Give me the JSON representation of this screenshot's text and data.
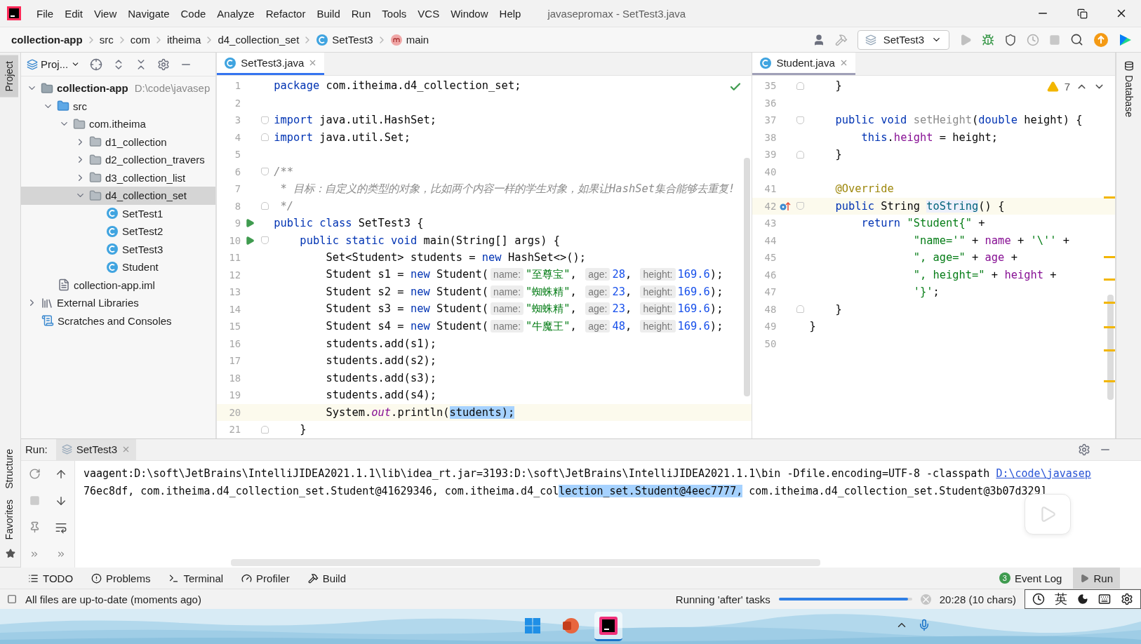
{
  "window": {
    "title": "javasepromax - SetTest3.java"
  },
  "menu": [
    "File",
    "Edit",
    "View",
    "Navigate",
    "Code",
    "Analyze",
    "Refactor",
    "Build",
    "Run",
    "Tools",
    "VCS",
    "Window",
    "Help"
  ],
  "breadcrumbs": [
    {
      "label": "collection-app",
      "kind": "project"
    },
    {
      "label": "src",
      "kind": "folder"
    },
    {
      "label": "com",
      "kind": "folder"
    },
    {
      "label": "itheima",
      "kind": "folder"
    },
    {
      "label": "d4_collection_set",
      "kind": "folder"
    },
    {
      "label": "SetTest3",
      "kind": "class"
    },
    {
      "label": "main",
      "kind": "method"
    }
  ],
  "run_configuration": {
    "label": "SetTest3"
  },
  "side_tabs_left": [
    {
      "label": "Project",
      "selected": true
    },
    {
      "label": "Structure",
      "selected": false
    },
    {
      "label": "Favorites",
      "selected": false
    }
  ],
  "side_tabs_right": [
    {
      "label": "Database",
      "selected": false
    }
  ],
  "project_panel": {
    "view": "Proj...",
    "tree": [
      {
        "label": "collection-app",
        "path": "D:\\code\\javasep",
        "kind": "module",
        "expanded": true,
        "selected": false,
        "children": [
          {
            "label": "src",
            "kind": "source",
            "expanded": true,
            "selected": false,
            "children": [
              {
                "label": "com.itheima",
                "kind": "package",
                "expanded": true,
                "selected": false,
                "children": [
                  {
                    "label": "d1_collection",
                    "kind": "package",
                    "expanded": false,
                    "selected": false
                  },
                  {
                    "label": "d2_collection_travers",
                    "kind": "package",
                    "expanded": false,
                    "selected": false
                  },
                  {
                    "label": "d3_collection_list",
                    "kind": "package",
                    "expanded": false,
                    "selected": false
                  },
                  {
                    "label": "d4_collection_set",
                    "kind": "package",
                    "expanded": true,
                    "selected": true,
                    "children": [
                      {
                        "label": "SetTest1",
                        "kind": "class",
                        "selected": false
                      },
                      {
                        "label": "SetTest2",
                        "kind": "class",
                        "selected": false
                      },
                      {
                        "label": "SetTest3",
                        "kind": "class",
                        "selected": false
                      },
                      {
                        "label": "Student",
                        "kind": "class",
                        "selected": false
                      }
                    ]
                  }
                ]
              }
            ]
          },
          {
            "label": "collection-app.iml",
            "kind": "iml",
            "selected": false
          }
        ]
      },
      {
        "label": "External Libraries",
        "kind": "library",
        "expanded": false,
        "selected": false
      },
      {
        "label": "Scratches and Consoles",
        "kind": "scratches",
        "selected": false
      }
    ]
  },
  "editors": [
    {
      "focused": true,
      "tab": {
        "label": "SetTest3.java",
        "selected": true
      },
      "indicator": {
        "kind": "ok"
      },
      "lines": [
        {
          "number": "1",
          "current": false,
          "tokens": [
            {
              "kind": "keyword",
              "text": "package"
            },
            {
              "kind": "plain",
              "text": " com.itheima.d4_collection_set;"
            }
          ]
        },
        {
          "number": "2",
          "current": false
        },
        {
          "number": "3",
          "current": false,
          "marks": [
            {
              "kind": "fold-start"
            }
          ],
          "tokens": [
            {
              "kind": "keyword",
              "text": "import"
            },
            {
              "kind": "plain",
              "text": " java.util.HashSet;"
            }
          ]
        },
        {
          "number": "4",
          "current": false,
          "marks": [
            {
              "kind": "fold-end"
            }
          ],
          "tokens": [
            {
              "kind": "keyword",
              "text": "import"
            },
            {
              "kind": "plain",
              "text": " java.util.Set;"
            }
          ]
        },
        {
          "number": "5",
          "current": false
        },
        {
          "number": "6",
          "current": false,
          "marks": [
            {
              "kind": "fold-start"
            }
          ],
          "tokens": [
            {
              "kind": "comment",
              "text": "/**"
            }
          ]
        },
        {
          "number": "7",
          "current": false,
          "tokens": [
            {
              "kind": "comment",
              "text": " * 目标：自定义的类型的对象，比如两个内容一样的学生对象，如果让HashSet集合能够去重复!"
            }
          ]
        },
        {
          "number": "8",
          "current": false,
          "marks": [
            {
              "kind": "fold-end"
            }
          ],
          "tokens": [
            {
              "kind": "comment",
              "text": " */"
            }
          ]
        },
        {
          "number": "9",
          "current": false,
          "marks": [
            {
              "kind": "run"
            }
          ],
          "tokens": [
            {
              "kind": "keyword",
              "text": "public class"
            },
            {
              "kind": "plain",
              "text": " SetTest3 {"
            }
          ]
        },
        {
          "number": "10",
          "current": false,
          "marks": [
            {
              "kind": "run"
            },
            {
              "kind": "fold-start"
            }
          ],
          "tokens": [
            {
              "kind": "keyword",
              "text": "    public static void"
            },
            {
              "kind": "plain",
              "text": " main(String[] args) {"
            }
          ]
        },
        {
          "number": "11",
          "current": false,
          "tokens": [
            {
              "kind": "plain",
              "text": "        Set<Student> students = "
            },
            {
              "kind": "keyword",
              "text": "new"
            },
            {
              "kind": "plain",
              "text": " HashSet<>();"
            }
          ]
        },
        {
          "number": "12",
          "current": false,
          "tokens": [
            {
              "kind": "plain",
              "text": "        Student s1 = "
            },
            {
              "kind": "keyword",
              "text": "new"
            },
            {
              "kind": "plain",
              "text": " Student("
            },
            {
              "kind": "hint",
              "text": "name:"
            },
            {
              "kind": "string",
              "text": "\"至尊宝\""
            },
            {
              "kind": "plain",
              "text": ", "
            },
            {
              "kind": "hint",
              "text": "age:"
            },
            {
              "kind": "number",
              "text": "28"
            },
            {
              "kind": "plain",
              "text": ", "
            },
            {
              "kind": "hint",
              "text": "height:"
            },
            {
              "kind": "number",
              "text": "169.6"
            },
            {
              "kind": "plain",
              "text": ");"
            }
          ]
        },
        {
          "number": "13",
          "current": false,
          "tokens": [
            {
              "kind": "plain",
              "text": "        Student s2 = "
            },
            {
              "kind": "keyword",
              "text": "new"
            },
            {
              "kind": "plain",
              "text": " Student("
            },
            {
              "kind": "hint",
              "text": "name:"
            },
            {
              "kind": "string",
              "text": "\"蜘蛛精\""
            },
            {
              "kind": "plain",
              "text": ", "
            },
            {
              "kind": "hint",
              "text": "age:"
            },
            {
              "kind": "number",
              "text": "23"
            },
            {
              "kind": "plain",
              "text": ", "
            },
            {
              "kind": "hint",
              "text": "height:"
            },
            {
              "kind": "number",
              "text": "169.6"
            },
            {
              "kind": "plain",
              "text": ");"
            }
          ]
        },
        {
          "number": "14",
          "current": false,
          "tokens": [
            {
              "kind": "plain",
              "text": "        Student s3 = "
            },
            {
              "kind": "keyword",
              "text": "new"
            },
            {
              "kind": "plain",
              "text": " Student("
            },
            {
              "kind": "hint",
              "text": "name:"
            },
            {
              "kind": "string",
              "text": "\"蜘蛛精\""
            },
            {
              "kind": "plain",
              "text": ", "
            },
            {
              "kind": "hint",
              "text": "age:"
            },
            {
              "kind": "number",
              "text": "23"
            },
            {
              "kind": "plain",
              "text": ", "
            },
            {
              "kind": "hint",
              "text": "height:"
            },
            {
              "kind": "number",
              "text": "169.6"
            },
            {
              "kind": "plain",
              "text": ");"
            }
          ]
        },
        {
          "number": "15",
          "current": false,
          "tokens": [
            {
              "kind": "plain",
              "text": "        Student s4 = "
            },
            {
              "kind": "keyword",
              "text": "new"
            },
            {
              "kind": "plain",
              "text": " Student("
            },
            {
              "kind": "hint",
              "text": "name:"
            },
            {
              "kind": "string",
              "text": "\"牛魔王\""
            },
            {
              "kind": "plain",
              "text": ", "
            },
            {
              "kind": "hint",
              "text": "age:"
            },
            {
              "kind": "number",
              "text": "48"
            },
            {
              "kind": "plain",
              "text": ", "
            },
            {
              "kind": "hint",
              "text": "height:"
            },
            {
              "kind": "number",
              "text": "169.6"
            },
            {
              "kind": "plain",
              "text": ");"
            }
          ]
        },
        {
          "number": "16",
          "current": false,
          "tokens": [
            {
              "kind": "plain",
              "text": "        students.add(s1);"
            }
          ]
        },
        {
          "number": "17",
          "current": false,
          "tokens": [
            {
              "kind": "plain",
              "text": "        students.add(s2);"
            }
          ]
        },
        {
          "number": "18",
          "current": false,
          "tokens": [
            {
              "kind": "plain",
              "text": "        students.add(s3);"
            }
          ]
        },
        {
          "number": "19",
          "current": false,
          "tokens": [
            {
              "kind": "plain",
              "text": "        students.add(s4);"
            }
          ]
        },
        {
          "number": "20",
          "current": true,
          "tokens": [
            {
              "kind": "plain",
              "text": "        System."
            },
            {
              "kind": "static",
              "text": "out"
            },
            {
              "kind": "plain",
              "text": ".println("
            },
            {
              "kind": "selected",
              "text": "students);"
            }
          ]
        },
        {
          "number": "21",
          "current": false,
          "marks": [
            {
              "kind": "fold-end"
            }
          ],
          "tokens": [
            {
              "kind": "plain",
              "text": "    }"
            }
          ]
        }
      ]
    },
    {
      "focused": false,
      "tab": {
        "label": "Student.java",
        "selected": true
      },
      "indicator": {
        "kind": "warnings",
        "count": "7"
      },
      "lines": [
        {
          "number": "35",
          "current": false,
          "marks": [
            {
              "kind": "fold-end"
            }
          ],
          "tokens": [
            {
              "kind": "plain",
              "text": "    }"
            }
          ]
        },
        {
          "number": "36",
          "current": false
        },
        {
          "number": "37",
          "current": false,
          "marks": [
            {
              "kind": "fold-start"
            }
          ],
          "tokens": [
            {
              "kind": "keyword",
              "text": "    public void "
            },
            {
              "kind": "unused",
              "text": "setHeight"
            },
            {
              "kind": "plain",
              "text": "("
            },
            {
              "kind": "keyword",
              "text": "double"
            },
            {
              "kind": "plain",
              "text": " height) {"
            }
          ]
        },
        {
          "number": "38",
          "current": false,
          "tokens": [
            {
              "kind": "keyword",
              "text": "        this"
            },
            {
              "kind": "plain",
              "text": "."
            },
            {
              "kind": "field",
              "text": "height"
            },
            {
              "kind": "plain",
              "text": " = height;"
            }
          ]
        },
        {
          "number": "39",
          "current": false,
          "marks": [
            {
              "kind": "fold-end"
            }
          ],
          "tokens": [
            {
              "kind": "plain",
              "text": "    }"
            }
          ]
        },
        {
          "number": "40",
          "current": false
        },
        {
          "number": "41",
          "current": false,
          "tokens": [
            {
              "kind": "annotation",
              "text": "    @Override"
            }
          ]
        },
        {
          "number": "42",
          "current": true,
          "marks": [
            {
              "kind": "override"
            },
            {
              "kind": "fold-start"
            }
          ],
          "tokens": [
            {
              "kind": "keyword",
              "text": "    public"
            },
            {
              "kind": "plain",
              "text": " String "
            },
            {
              "kind": "method",
              "text": "toString"
            },
            {
              "kind": "plain",
              "text": "() {"
            }
          ]
        },
        {
          "number": "43",
          "current": false,
          "tokens": [
            {
              "kind": "keyword",
              "text": "        return"
            },
            {
              "kind": "string",
              "text": " \"Student{\""
            },
            {
              "kind": "plain",
              "text": " +"
            }
          ]
        },
        {
          "number": "44",
          "current": false,
          "tokens": [
            {
              "kind": "string",
              "text": "                \"name='\""
            },
            {
              "kind": "plain",
              "text": " + "
            },
            {
              "kind": "field",
              "text": "name"
            },
            {
              "kind": "plain",
              "text": " + "
            },
            {
              "kind": "string",
              "text": "'\\''"
            },
            {
              "kind": "plain",
              "text": " +"
            }
          ]
        },
        {
          "number": "45",
          "current": false,
          "tokens": [
            {
              "kind": "string",
              "text": "                \", age=\""
            },
            {
              "kind": "plain",
              "text": " + "
            },
            {
              "kind": "field",
              "text": "age"
            },
            {
              "kind": "plain",
              "text": " +"
            }
          ]
        },
        {
          "number": "46",
          "current": false,
          "tokens": [
            {
              "kind": "string",
              "text": "                \", height=\""
            },
            {
              "kind": "plain",
              "text": " + "
            },
            {
              "kind": "field",
              "text": "height"
            },
            {
              "kind": "plain",
              "text": " +"
            }
          ]
        },
        {
          "number": "47",
          "current": false,
          "tokens": [
            {
              "kind": "string",
              "text": "                '}'"
            },
            {
              "kind": "plain",
              "text": ";"
            }
          ]
        },
        {
          "number": "48",
          "current": false,
          "marks": [
            {
              "kind": "fold-end"
            }
          ],
          "tokens": [
            {
              "kind": "plain",
              "text": "    }"
            }
          ]
        },
        {
          "number": "49",
          "current": false,
          "tokens": [
            {
              "kind": "plain",
              "text": "}"
            }
          ]
        },
        {
          "number": "50",
          "current": false
        }
      ]
    }
  ],
  "run_panel": {
    "label": "Run:",
    "tab": {
      "label": "SetTest3",
      "selected": true
    },
    "console": [
      [
        {
          "kind": "plain",
          "text": "vaagent:D:\\soft\\JetBrains\\IntelliJIDEA2021.1.1\\lib\\idea_rt.jar=3193:D:\\soft\\JetBrains\\IntelliJIDEA2021.1.1\\bin -Dfile.encoding=UTF-8 -classpath "
        },
        {
          "kind": "link",
          "text": "D:\\code\\javasep"
        }
      ],
      [
        {
          "kind": "plain",
          "text": "76ec8df, com.itheima.d4_collection_set.Student@41629346, com.itheima.d4_col"
        },
        {
          "kind": "selected",
          "text": "lection_set.Student@4eec7777,"
        },
        {
          "kind": "plain",
          "text": " com.itheima.d4_collection_set.Student@3b07d329]"
        }
      ]
    ]
  },
  "tool_windows": [
    {
      "label": "TODO",
      "kind": "todo",
      "selected": false
    },
    {
      "label": "Problems",
      "kind": "problems",
      "selected": false
    },
    {
      "label": "Terminal",
      "kind": "terminal",
      "selected": false
    },
    {
      "label": "Profiler",
      "kind": "profiler",
      "selected": false
    },
    {
      "label": "Build",
      "kind": "build",
      "selected": false
    },
    {
      "label": "Event Log",
      "kind": "event-log",
      "badge": "3",
      "selected": false
    },
    {
      "label": "Run",
      "kind": "run",
      "selected": true
    }
  ],
  "status_bar": {
    "message": "All files are up-to-date (moments ago)",
    "task": "Running 'after' tasks",
    "progress": {
      "level": 0.97
    },
    "caret": "20:28 (10 chars)",
    "ime": "英"
  },
  "taskbar": {
    "apps": [
      {
        "kind": "windows",
        "active": false
      },
      {
        "kind": "slides",
        "active": false
      },
      {
        "kind": "ide",
        "active": true
      }
    ]
  }
}
